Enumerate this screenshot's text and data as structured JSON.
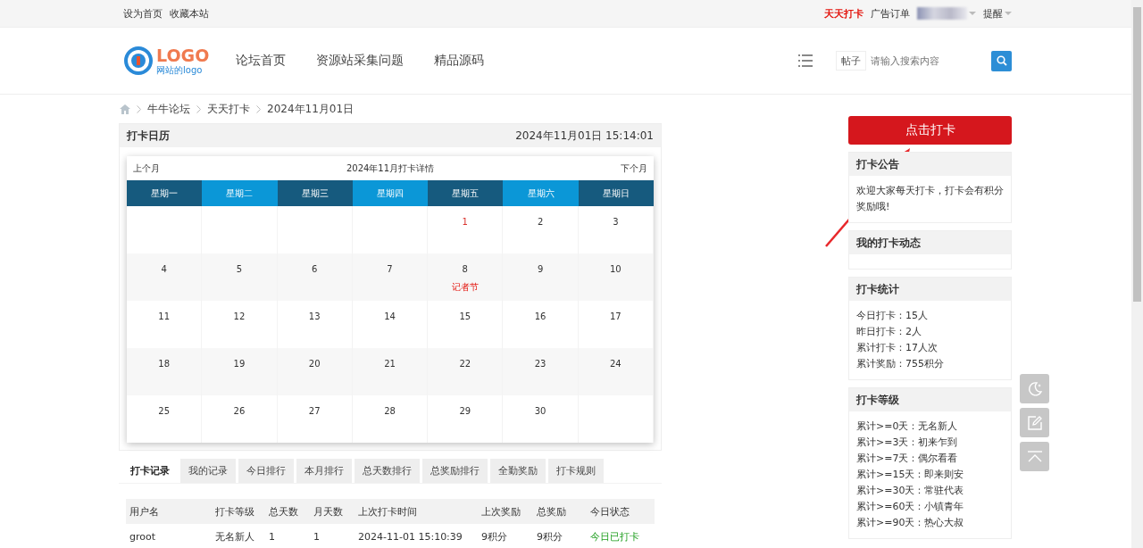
{
  "topbar": {
    "left_links": [
      "设为首页",
      "收藏本站"
    ],
    "highlight_link": "天天打卡",
    "ad_link": "广告订单",
    "remind": "提醒"
  },
  "header": {
    "logo_text": "LOGO",
    "logo_sub": "网站的logo",
    "nav": [
      "论坛首页",
      "资源站采集问题",
      "精品源码"
    ],
    "search_scope": "帖子",
    "search_placeholder": "请输入搜索内容"
  },
  "breadcrumb": [
    "牛牛论坛",
    "天天打卡",
    "2024年11月01日"
  ],
  "calendar_panel": {
    "title": "打卡日历",
    "datetime": "2024年11月01日 15:14:01",
    "prev": "上个月",
    "heading": "2024年11月打卡详情",
    "next": "下个月",
    "weekdays": [
      "星期一",
      "星期二",
      "星期三",
      "星期四",
      "星期五",
      "星期六",
      "星期日"
    ],
    "cells": [
      {
        "kind": "blank"
      },
      {
        "kind": "blank"
      },
      {
        "kind": "blank"
      },
      {
        "kind": "blank"
      },
      {
        "kind": "day",
        "day": "1",
        "today": true
      },
      {
        "kind": "day",
        "day": "2",
        "today": false
      },
      {
        "kind": "day",
        "day": "3",
        "today": false
      },
      {
        "kind": "day",
        "day": "4",
        "today": false
      },
      {
        "kind": "day",
        "day": "5",
        "today": false
      },
      {
        "kind": "day",
        "day": "6",
        "today": false
      },
      {
        "kind": "day",
        "day": "7",
        "today": false
      },
      {
        "kind": "day",
        "day": "8",
        "today": false,
        "festival": "记者节"
      },
      {
        "kind": "day",
        "day": "9",
        "today": false
      },
      {
        "kind": "day",
        "day": "10",
        "today": false
      },
      {
        "kind": "day",
        "day": "11",
        "today": false
      },
      {
        "kind": "day",
        "day": "12",
        "today": false
      },
      {
        "kind": "day",
        "day": "13",
        "today": false
      },
      {
        "kind": "day",
        "day": "14",
        "today": false
      },
      {
        "kind": "day",
        "day": "15",
        "today": false
      },
      {
        "kind": "day",
        "day": "16",
        "today": false
      },
      {
        "kind": "day",
        "day": "17",
        "today": false
      },
      {
        "kind": "day",
        "day": "18",
        "today": false
      },
      {
        "kind": "day",
        "day": "19",
        "today": false
      },
      {
        "kind": "day",
        "day": "20",
        "today": false
      },
      {
        "kind": "day",
        "day": "21",
        "today": false
      },
      {
        "kind": "day",
        "day": "22",
        "today": false
      },
      {
        "kind": "day",
        "day": "23",
        "today": false
      },
      {
        "kind": "day",
        "day": "24",
        "today": false
      },
      {
        "kind": "day",
        "day": "25",
        "today": false
      },
      {
        "kind": "day",
        "day": "26",
        "today": false
      },
      {
        "kind": "day",
        "day": "27",
        "today": false
      },
      {
        "kind": "day",
        "day": "28",
        "today": false
      },
      {
        "kind": "day",
        "day": "29",
        "today": false
      },
      {
        "kind": "day",
        "day": "30",
        "today": false
      },
      {
        "kind": "blank"
      }
    ]
  },
  "tabs": [
    {
      "label": "打卡记录",
      "selected": true
    },
    {
      "label": "我的记录",
      "selected": false
    },
    {
      "label": "今日排行",
      "selected": false
    },
    {
      "label": "本月排行",
      "selected": false
    },
    {
      "label": "总天数排行",
      "selected": false
    },
    {
      "label": "总奖励排行",
      "selected": false
    },
    {
      "label": "全勤奖励",
      "selected": false
    },
    {
      "label": "打卡规则",
      "selected": false
    }
  ],
  "table": {
    "columns": [
      "用户名",
      "打卡等级",
      "总天数",
      "月天数",
      "上次打卡时间",
      "上次奖励",
      "总奖励",
      "今日状态"
    ],
    "rows": [
      {
        "cells": [
          "groot",
          "无名新人",
          "1",
          "1",
          "2024-11-01 15:10:39",
          "9积分",
          "9积分"
        ],
        "status": "今日已打卡",
        "checked_in": true
      }
    ]
  },
  "sidebar": {
    "checkin_button": "点击打卡",
    "panels": [
      {
        "title": "打卡公告",
        "lines": [
          "欢迎大家每天打卡，打卡会有积分奖励哦!"
        ]
      },
      {
        "title": "我的打卡动态"
      },
      {
        "title": "打卡统计",
        "lines": [
          "今日打卡：15人",
          "昨日打卡：2人",
          "累计打卡：17人次",
          "累计奖励：755积分"
        ]
      },
      {
        "title": "打卡等级",
        "lines": [
          "累计>=0天：无名新人",
          "累计>=3天：初来乍到",
          "累计>=7天：偶尔看看",
          "累计>=15天：即来则安",
          "累计>=30天：常驻代表",
          "累计>=60天：小镇青年",
          "累计>=90天：热心大叔"
        ]
      }
    ]
  }
}
